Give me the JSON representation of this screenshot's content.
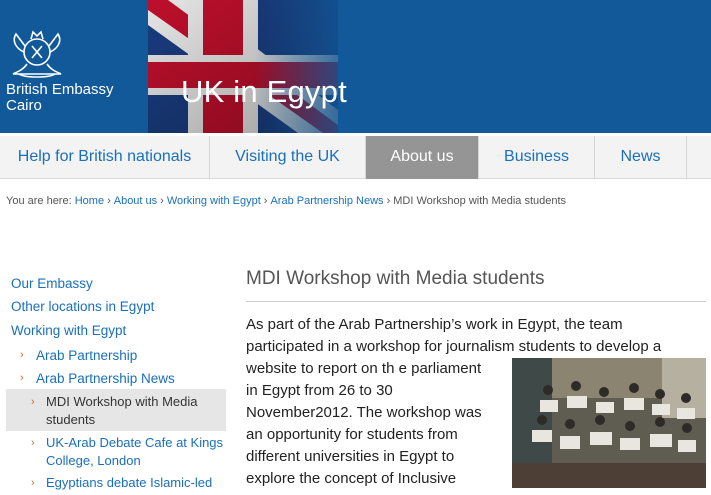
{
  "header": {
    "embassy_line1": "British Embassy",
    "embassy_line2": "Cairo",
    "site_title": "UK in Egypt",
    "colors": {
      "header_bg": "#12599a",
      "flag_red": "#c8102e"
    }
  },
  "nav": {
    "items": [
      {
        "label": "Help for British nationals",
        "active": false
      },
      {
        "label": "Visiting the UK",
        "active": false
      },
      {
        "label": "About us",
        "active": true
      },
      {
        "label": "Business",
        "active": false
      },
      {
        "label": "News",
        "active": false
      }
    ]
  },
  "breadcrumb": {
    "prefix": "You are here:",
    "separator": "›",
    "links": [
      "Home",
      "About us",
      "Working with Egypt",
      "Arab Partnership News"
    ],
    "current": "MDI Workshop with Media students"
  },
  "sidebar": {
    "top": [
      "Our Embassy",
      "Other locations in Egypt",
      "Working with Egypt"
    ],
    "sub": [
      "Arab Partnership",
      "Arab Partnership News"
    ],
    "current_line1": "MDI Workshop with Media",
    "current_line2": "students",
    "sub2": [
      {
        "line1": "UK-Arab Debate Cafe at Kings",
        "line2": "College, London"
      },
      {
        "line1": "Egyptians debate Islamic-led",
        "line2": ""
      }
    ],
    "chevron": "›"
  },
  "article": {
    "title": "MDI Workshop with Media students",
    "lines_full": [
      "As part of the Arab Partnership’s work in Egypt, the team",
      "participated in a workshop for journalism students to develop a"
    ],
    "lines_wrapped": [
      "website to report on th e parliament",
      "in Egypt from 26 to 30",
      "November2012. The workshop was",
      "an opportunity for students from",
      "different universities in Egypt to",
      "explore the concept of Inclusive"
    ],
    "photo_icon": "group-photo"
  }
}
